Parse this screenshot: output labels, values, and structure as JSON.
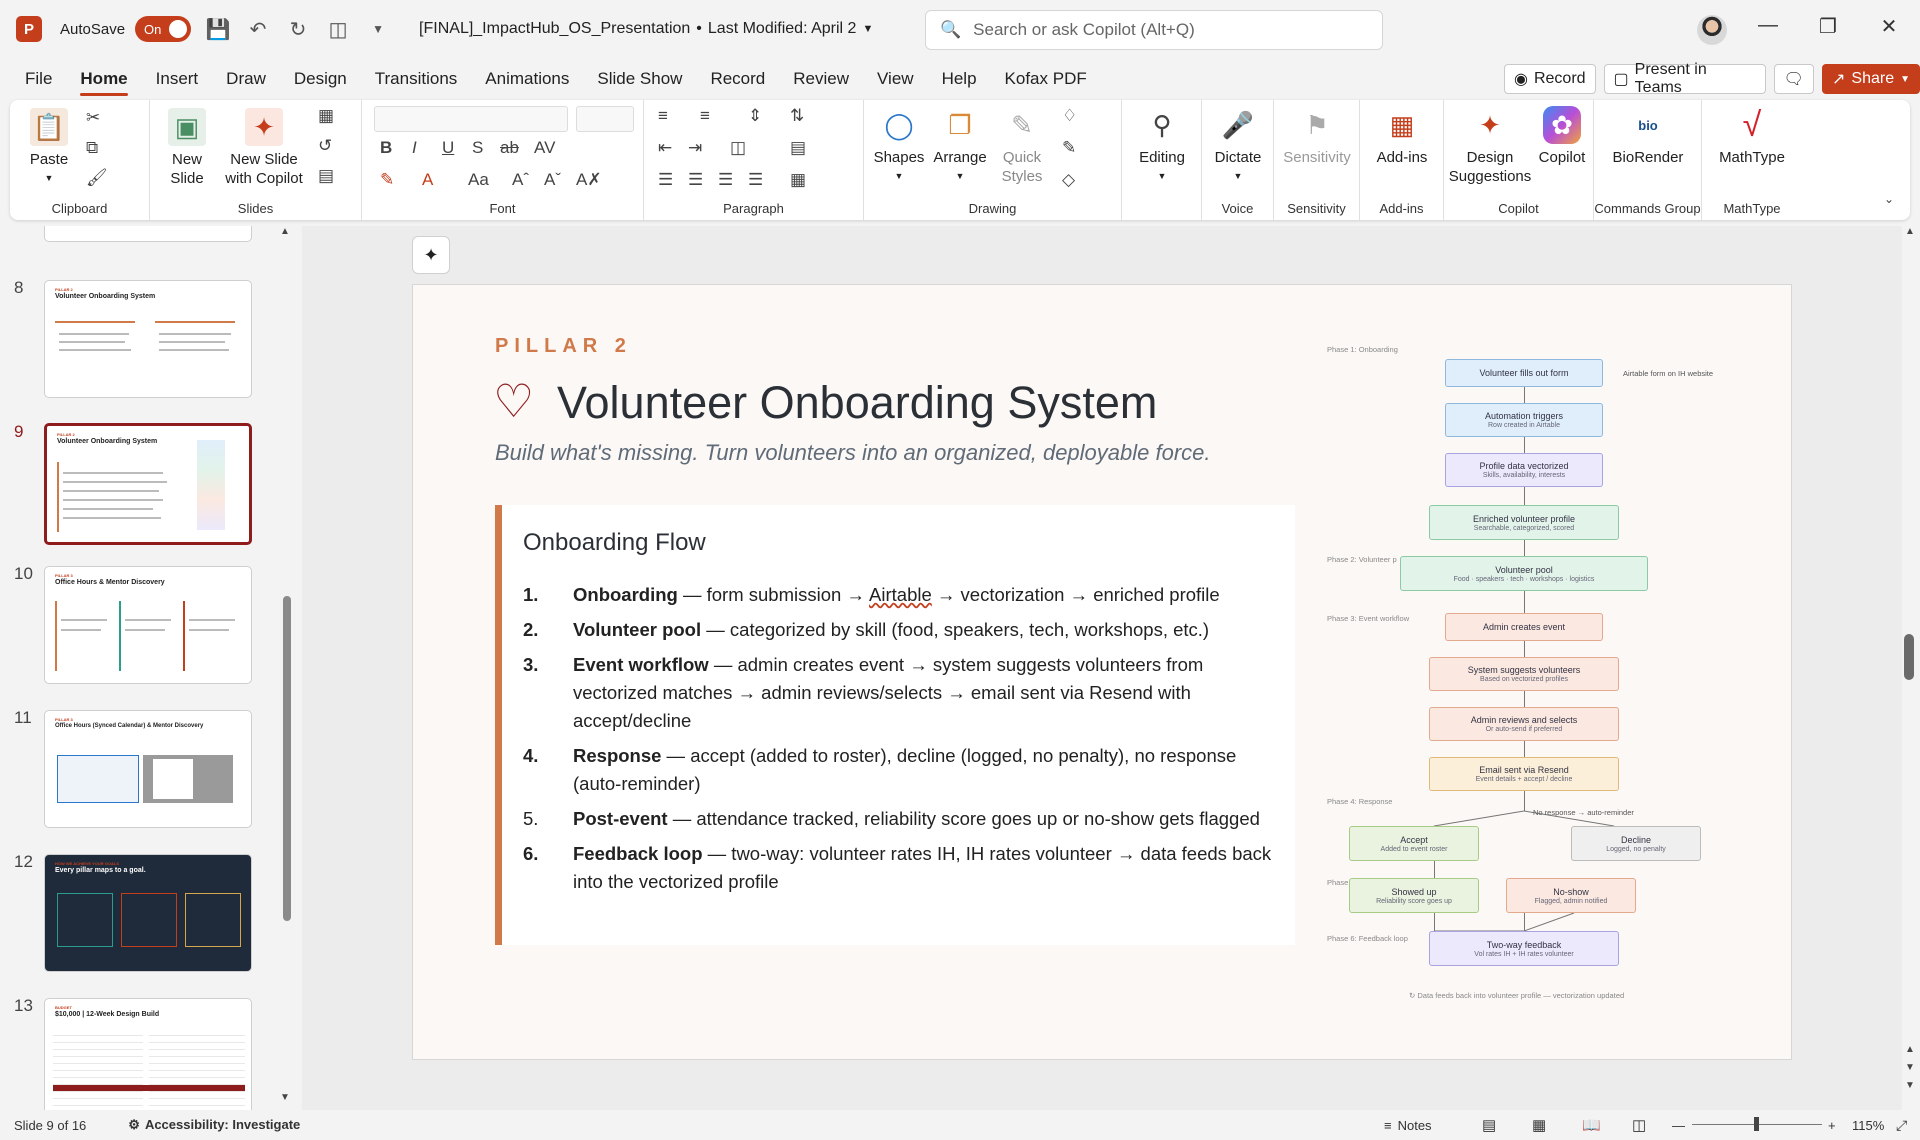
{
  "app": {
    "logo_letter": "P",
    "autosave_label": "AutoSave",
    "autosave_state": "On",
    "doc_title": "[FINAL]_ImpactHub_OS_Presentation",
    "last_modified": "Last Modified: April 2",
    "search_placeholder": "Search or ask Copilot (Alt+Q)",
    "accent_color": "#c43e1c"
  },
  "menu": {
    "tabs": [
      "File",
      "Home",
      "Insert",
      "Draw",
      "Design",
      "Transitions",
      "Animations",
      "Slide Show",
      "Record",
      "Review",
      "View",
      "Help",
      "Kofax PDF"
    ],
    "active": "Home",
    "record_label": "Record",
    "present_label": "Present in Teams",
    "share_label": "Share"
  },
  "ribbon": {
    "paste": "Paste",
    "new_slide": "New Slide",
    "new_slide_copilot": "New Slide with Copilot",
    "shapes": "Shapes",
    "arrange": "Arrange",
    "quick_styles": "Quick Styles",
    "editing": "Editing",
    "dictate": "Dictate",
    "sensitivity": "Sensitivity",
    "addins": "Add-ins",
    "design_suggestions": "Design Suggestions",
    "copilot": "Copilot",
    "biorender": "BioRender",
    "mathtype": "MathType",
    "groups": {
      "clipboard": "Clipboard",
      "slides": "Slides",
      "font": "Font",
      "paragraph": "Paragraph",
      "drawing": "Drawing",
      "voice": "Voice",
      "sensitivity": "Sensitivity",
      "addins": "Add-ins",
      "copilot": "Copilot",
      "commands": "Commands Group",
      "mathtype": "MathType"
    }
  },
  "thumbnails": [
    {
      "num": "8",
      "kicker": "PILLAR 2",
      "title": "Volunteer Onboarding System",
      "selected": false
    },
    {
      "num": "9",
      "kicker": "PILLAR 2",
      "title": "Volunteer Onboarding System",
      "selected": true
    },
    {
      "num": "10",
      "kicker": "PILLAR 3",
      "title": "Office Hours & Mentor Discovery",
      "selected": false
    },
    {
      "num": "11",
      "kicker": "PILLAR 3",
      "title": "Office Hours (Synced Calendar) & Mentor Discovery",
      "selected": false
    },
    {
      "num": "12",
      "kicker": "HOW WE ACHIEVE YOUR GOALS",
      "title": "Every pillar maps to a goal.",
      "selected": false
    },
    {
      "num": "13",
      "kicker": "BUDGET",
      "title": "$10,000 | 12-Week Design Build",
      "selected": false
    }
  ],
  "slide": {
    "kicker": "PILLAR 2",
    "title": "Volunteer Onboarding System",
    "subtitle": "Build what's missing. Turn volunteers into an organized, deployable force.",
    "flow_heading": "Onboarding Flow",
    "items": [
      {
        "num": "1.",
        "bold": "Onboarding",
        "rest_a": " — form submission → ",
        "link": "Airtable",
        "rest_b": " → vectorization → enriched profile"
      },
      {
        "num": "2.",
        "bold": "Volunteer pool",
        "rest_a": " — categorized by skill (food, speakers, tech, workshops, etc.)",
        "link": "",
        "rest_b": ""
      },
      {
        "num": "3.",
        "bold": "Event workflow",
        "rest_a": " — admin creates event → system suggests volunteers from vectorized matches → admin reviews/selects → email sent via Resend with accept/decline",
        "link": "",
        "rest_b": ""
      },
      {
        "num": "4.",
        "bold": "Response",
        "rest_a": " — accept (added to roster), decline (logged, no penalty), no response (auto-reminder)",
        "link": "",
        "rest_b": ""
      },
      {
        "num": "5.",
        "bold": " Post-event",
        "rest_a": " — attendance tracked, reliability score goes up or no-show gets flagged",
        "link": "",
        "rest_b": ""
      },
      {
        "num": "6.",
        "bold": "Feedback loop",
        "rest_a": " — two-way: volunteer rates IH, IH rates volunteer → data feeds back into the vectorized profile",
        "link": "",
        "rest_b": ""
      }
    ],
    "diagram": {
      "phases": [
        "Phase 1: Onboarding",
        "Phase 2: Volunteer p",
        "Phase 3: Event workflow",
        "Phase 4: Response",
        "Phase 5: Post-event",
        "Phase 6: Feedback loop"
      ],
      "nodes": [
        {
          "t": "Volunteer fills out form",
          "s": ""
        },
        {
          "t": "Automation triggers",
          "s": "Row created in Airtable"
        },
        {
          "t": "Profile data vectorized",
          "s": "Skills, availability, interests"
        },
        {
          "t": "Enriched volunteer profile",
          "s": "Searchable, categorized, scored"
        },
        {
          "t": "Volunteer pool",
          "s": "Food · speakers · tech · workshops · logistics"
        },
        {
          "t": "Admin creates event",
          "s": ""
        },
        {
          "t": "System suggests volunteers",
          "s": "Based on vectorized profiles"
        },
        {
          "t": "Admin reviews and selects",
          "s": "Or auto-send if preferred"
        },
        {
          "t": "Email sent via Resend",
          "s": "Event details + accept / decline"
        },
        {
          "t": "Accept",
          "s": "Added to event roster"
        },
        {
          "t": "Decline",
          "s": "Logged, no penalty"
        },
        {
          "t": "Showed up",
          "s": "Reliability score goes up"
        },
        {
          "t": "No-show",
          "s": "Flagged, admin notified"
        },
        {
          "t": "Two-way feedback",
          "s": "Vol rates IH + IH rates volunteer"
        }
      ],
      "side_note": "Airtable form on IH website",
      "no_response": "No response → auto-reminder",
      "footer": "↻ Data feeds back into volunteer profile — vectorization updated"
    }
  },
  "status": {
    "slide_info": "Slide 9 of 16",
    "accessibility": "Accessibility: Investigate",
    "notes": "Notes",
    "zoom": "115%"
  }
}
